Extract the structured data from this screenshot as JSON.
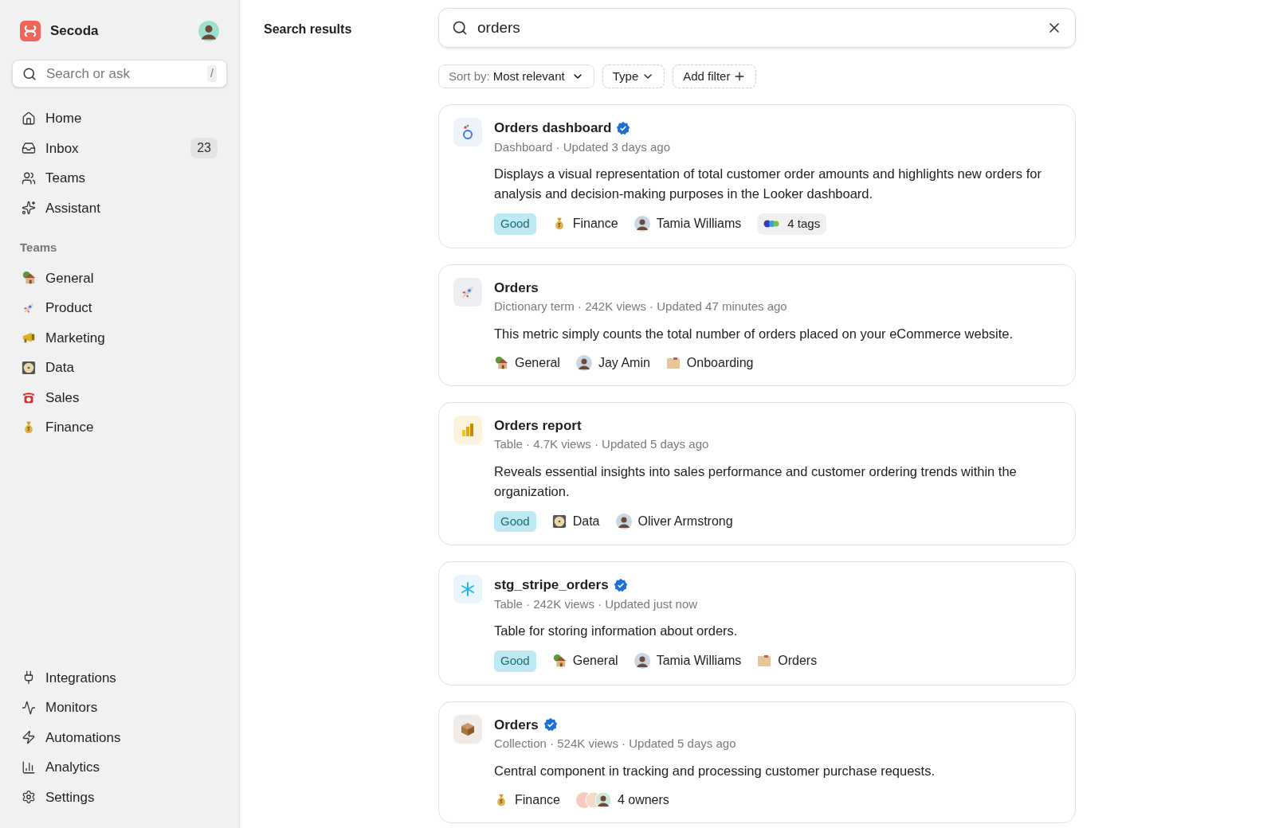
{
  "sidebar": {
    "brand": {
      "name": "Secoda"
    },
    "search": {
      "placeholder": "Search or ask",
      "shortcut": "/"
    },
    "nav": [
      {
        "label": "Home",
        "kind": "home"
      },
      {
        "label": "Inbox",
        "kind": "inbox",
        "badge": "23"
      },
      {
        "label": "Teams",
        "kind": "users"
      },
      {
        "label": "Assistant",
        "kind": "sparkles"
      }
    ],
    "teams_heading": "Teams",
    "teams": [
      {
        "label": "General",
        "kind": "house"
      },
      {
        "label": "Product",
        "kind": "rocket"
      },
      {
        "label": "Marketing",
        "kind": "megaphone"
      },
      {
        "label": "Data",
        "kind": "disc"
      },
      {
        "label": "Sales",
        "kind": "phone"
      },
      {
        "label": "Finance",
        "kind": "moneybag"
      }
    ],
    "footer_nav": [
      {
        "label": "Integrations",
        "kind": "plug"
      },
      {
        "label": "Monitors",
        "kind": "activity"
      },
      {
        "label": "Automations",
        "kind": "zap"
      },
      {
        "label": "Analytics",
        "kind": "chart"
      },
      {
        "label": "Settings",
        "kind": "settings"
      }
    ]
  },
  "main": {
    "title": "Search results",
    "search": {
      "value": "orders"
    },
    "filters": [
      {
        "kind": "sort",
        "label": "Sort by:",
        "value": "Most relevant"
      },
      {
        "kind": "dropdown",
        "label": "Type"
      },
      {
        "kind": "add",
        "label": "Add filter"
      }
    ],
    "results": [
      {
        "kind": "looker",
        "title": "Orders dashboard",
        "verified": true,
        "meta": "Dashboard · Updated 3 days ago",
        "description": "Displays a visual representation of total customer order amounts and highlights new orders for analysis and decision-making purposes in the Looker dashboard.",
        "chips": [
          {
            "kind": "status",
            "label": "Good"
          },
          {
            "kind": "team_moneybag",
            "label": "Finance"
          },
          {
            "kind": "person",
            "label": "Tamia Williams"
          },
          {
            "kind": "tags",
            "label": "4 tags"
          }
        ]
      },
      {
        "kind": "rocket",
        "title": "Orders",
        "verified": false,
        "meta": "Dictionary term · 242K views · Updated 47 minutes ago",
        "description": "This metric simply counts the total number of orders placed on your eCommerce website.",
        "chips": [
          {
            "kind": "team_house",
            "label": "General"
          },
          {
            "kind": "person",
            "label": "Jay Amin"
          },
          {
            "kind": "collection",
            "label": "Onboarding"
          }
        ]
      },
      {
        "kind": "powerbi",
        "title": "Orders report",
        "verified": false,
        "meta": "Table · 4.7K views · Updated 5 days ago",
        "description": "Reveals essential insights into sales performance and customer ordering trends within the organization.",
        "chips": [
          {
            "kind": "status",
            "label": "Good"
          },
          {
            "kind": "team_disc",
            "label": "Data"
          },
          {
            "kind": "person",
            "label": "Oliver Armstrong"
          }
        ]
      },
      {
        "kind": "snowflake",
        "title": "stg_stripe_orders",
        "verified": true,
        "meta": "Table · 242K views · Updated just now",
        "description": "Table for storing information about orders.",
        "chips": [
          {
            "kind": "status",
            "label": "Good"
          },
          {
            "kind": "team_house",
            "label": "General"
          },
          {
            "kind": "person",
            "label": "Tamia Williams"
          },
          {
            "kind": "collection",
            "label": "Orders"
          }
        ]
      },
      {
        "kind": "box",
        "title": "Orders",
        "verified": true,
        "meta": "Collection · 524K views · Updated 5 days ago",
        "description": "Central component in tracking and processing customer purchase requests.",
        "chips": [
          {
            "kind": "team_moneybag",
            "label": "Finance"
          },
          {
            "kind": "owners",
            "label": "4 owners"
          }
        ]
      }
    ]
  }
}
